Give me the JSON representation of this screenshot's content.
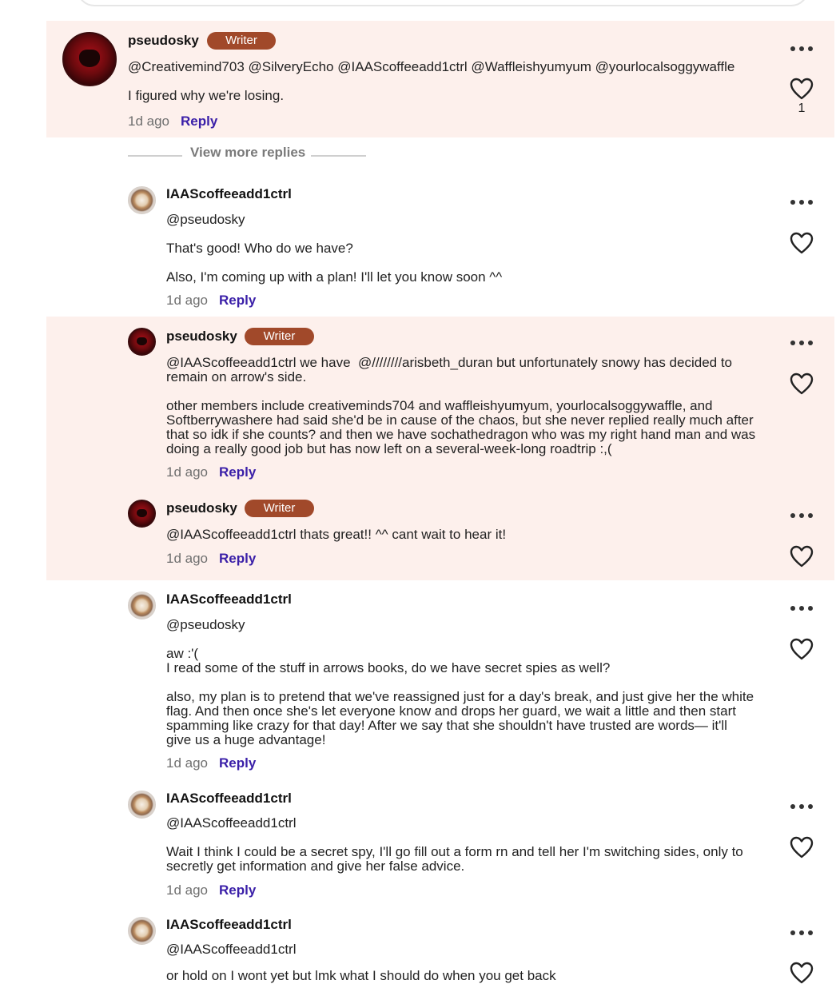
{
  "thread": {
    "view_more_label": "View more replies",
    "comments": [
      {
        "author": "pseudosky",
        "badge": "Writer",
        "mentions": "@Creativemind703 @SilveryEcho @IAAScoffeeadd1ctrl @Waffleishyumyum @yourlocalsoggywaffle",
        "body": "I figured why we're losing.",
        "time": "1d ago",
        "reply_label": "Reply",
        "like_count": "1"
      },
      {
        "author": "IAAScoffeeadd1ctrl",
        "mention": "@pseudosky",
        "body1": "That's good! Who do we have?",
        "body2": "Also, I'm coming up with a plan! I'll let you know soon ^^",
        "time": "1d ago",
        "reply_label": "Reply"
      },
      {
        "author": "pseudosky",
        "badge": "Writer",
        "body1": "@IAAScoffeeadd1ctrl we have  @////////arisbeth_duran but unfortunately snowy has decided to\nremain on arrow's side.",
        "body2": "other members include creativeminds704 and waffleishyumyum, yourlocalsoggywaffle, and\nSoftberrywashere had said she'd be in cause of the chaos, but she never replied really much after\nthat so idk if she counts? and then we have sochathedragon who was my right hand man and was\ndoing a really good job but has now left on a several-week-long roadtrip :,(",
        "time": "1d ago",
        "reply_label": "Reply"
      },
      {
        "author": "pseudosky",
        "badge": "Writer",
        "body": "@IAAScoffeeadd1ctrl thats great!! ^^ cant wait to hear it!",
        "time": "1d ago",
        "reply_label": "Reply"
      },
      {
        "author": "IAAScoffeeadd1ctrl",
        "mention": "@pseudosky",
        "body1": "aw :'(\nI read some of the stuff in arrows books, do we have secret spies as well?",
        "body2": "also, my plan is to pretend that we've reassigned just for a day's break, and just give her the white\nflag. And then once she's let everyone know and drops her guard, we wait a little and then start\nspamming like crazy for that day! After we say that she shouldn't have trusted are words— it'll\ngive us a huge advantage!",
        "time": "1d ago",
        "reply_label": "Reply"
      },
      {
        "author": "IAAScoffeeadd1ctrl",
        "mention": "@IAAScoffeeadd1ctrl",
        "body": "Wait I think I could be a secret spy, I'll go fill out a form rn and tell her I'm switching sides, only to\nsecretly get information and give her false advice.",
        "time": "1d ago",
        "reply_label": "Reply"
      },
      {
        "author": "IAAScoffeeadd1ctrl",
        "mention": "@IAAScoffeeadd1ctrl",
        "body": "or hold on I wont yet but lmk what I should do when you get back"
      }
    ]
  }
}
